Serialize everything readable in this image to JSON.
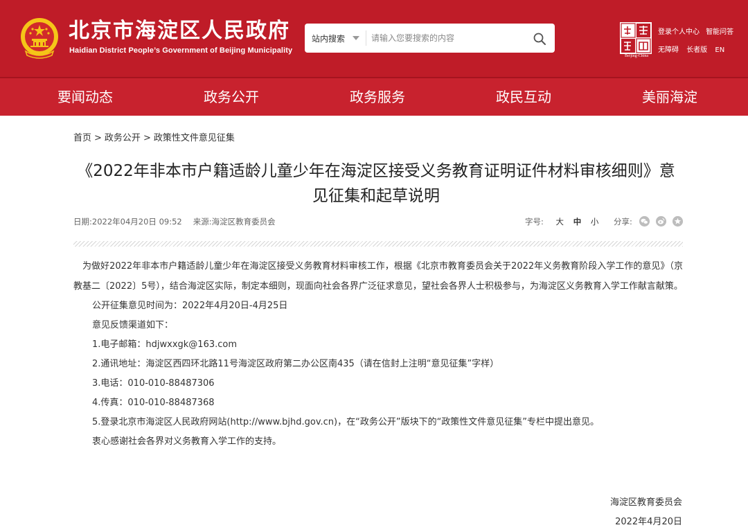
{
  "header": {
    "title": "北京市海淀区人民政府",
    "subtitle": "Haidian District People’s Government of Beijing Municipality",
    "search": {
      "scope": "站内搜索",
      "placeholder": "请输入您要搜索的内容"
    },
    "beijing_logo_caption": "Beijing-China",
    "links_row1": [
      "登录个人中心",
      "智能问答"
    ],
    "links_row2": [
      "无障碍",
      "长者版",
      "EN"
    ]
  },
  "nav": {
    "items": [
      "要闻动态",
      "政务公开",
      "政务服务",
      "政民互动",
      "美丽海淀"
    ]
  },
  "breadcrumb": {
    "items": [
      "首页",
      "政务公开",
      "政策性文件意见征集"
    ],
    "separator": ">"
  },
  "article": {
    "title": "《2022年非本市户籍适龄儿童少年在海淀区接受义务教育证明证件材料审核细则》意见征集和起草说明",
    "date": "日期:2022年04月20日 09:52",
    "source": "来源:海淀区教育委员会",
    "font_size_label": "字号:",
    "font_sizes": [
      "大",
      "中",
      "小"
    ],
    "share_label": "分享:",
    "intro": "为做好2022年非本市户籍适龄儿童少年在海淀区接受义务教育材料审核工作，根据《北京市教育委员会关于2022年义务教育阶段入学工作的意见》（京教基二〔2022〕5号），结合海淀区实际，制定本细则，现面向社会各界广泛征求意见，望社会各界人士积极参与，为海淀区义务教育入学工作献言献策。",
    "lines": [
      "公开征集意见时间为：2022年4月20日-4月25日",
      "意见反馈渠道如下：",
      "1.电子邮箱：hdjwxxgk@163.com",
      "2.通讯地址：海淀区西四环北路11号海淀区政府第二办公区南435（请在信封上注明“意见征集”字样）",
      "3.电话：010-010-88487306",
      "4.传真：010-010-88487368",
      "5.登录北京市海淀区人民政府网站(http://www.bjhd.gov.cn)，在“政务公开”版块下的“政策性文件意见征集”专栏中提出意见。",
      "衷心感谢社会各界对义务教育入学工作的支持。"
    ],
    "signature": {
      "org": "海淀区教育委员会",
      "date": "2022年4月20日"
    }
  },
  "colors": {
    "header_red": "#bf1c28",
    "nav_red": "#c8222e",
    "emblem_gold": "#f5c518"
  },
  "icons": [
    "national-emblem-icon",
    "search-icon",
    "chevron-down-icon",
    "beijing-logo-icon",
    "wechat-share-icon",
    "weibo-share-icon",
    "qzone-share-icon"
  ]
}
